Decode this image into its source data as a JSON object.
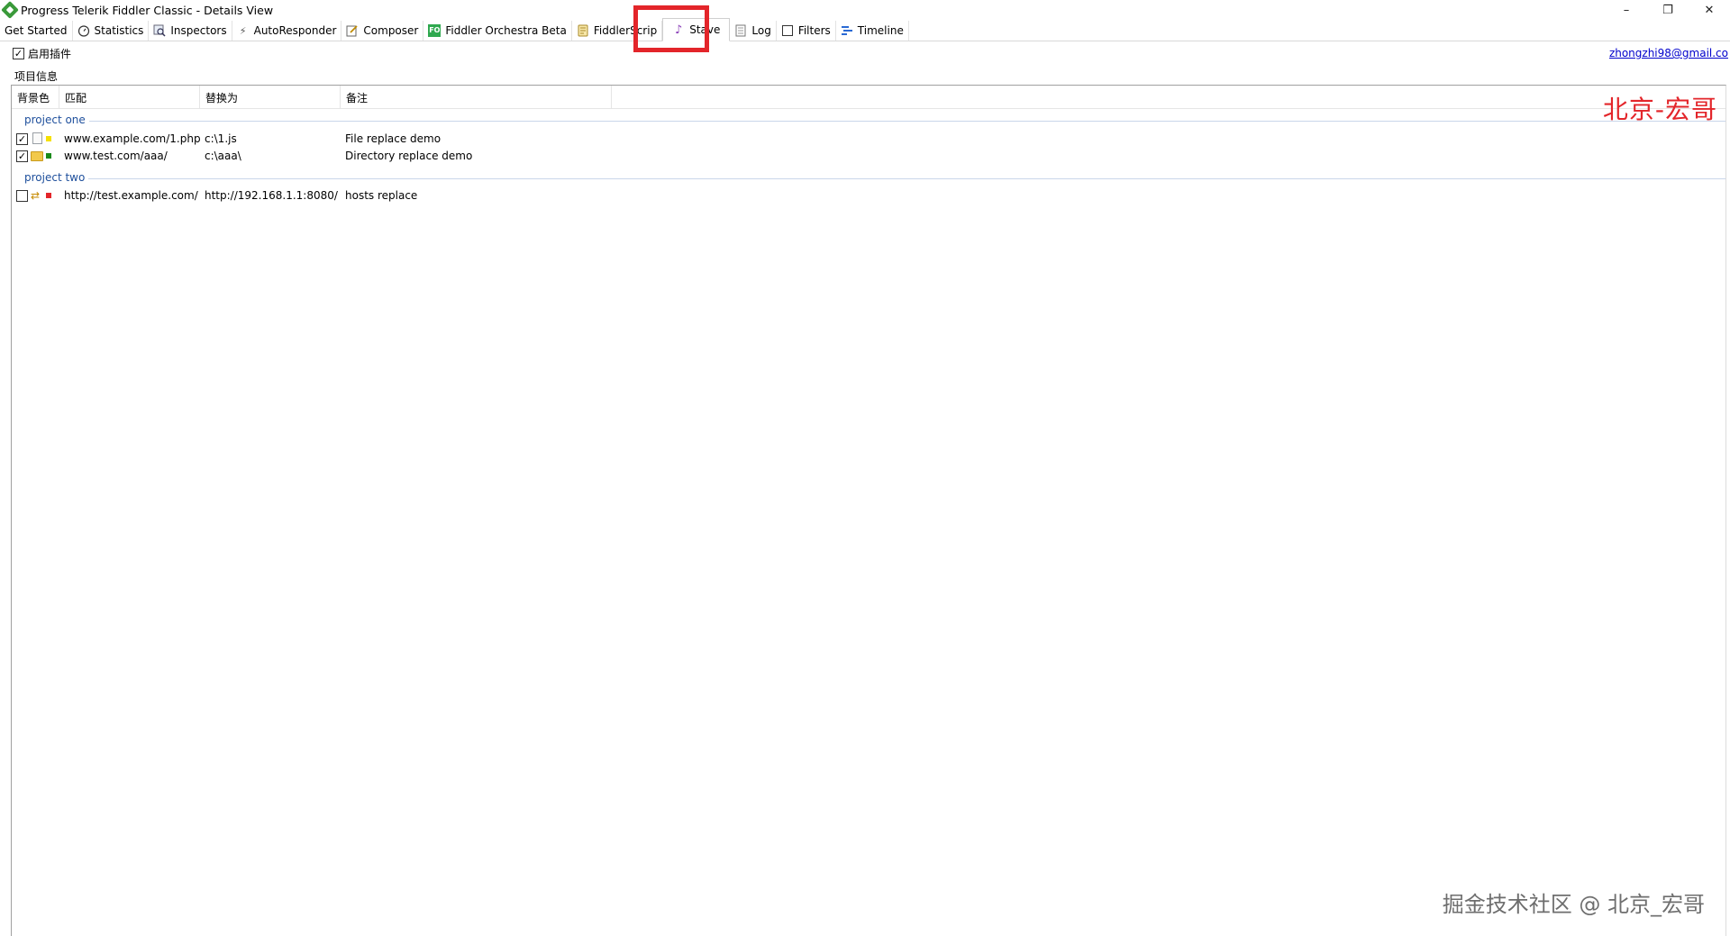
{
  "window": {
    "title": "Progress Telerik Fiddler Classic - Details View",
    "controls": {
      "minimize": "–",
      "restore": "❐",
      "close": "✕"
    }
  },
  "tabs": [
    {
      "label": "Get Started",
      "icon": ""
    },
    {
      "label": "Statistics",
      "icon": "stopwatch-icon"
    },
    {
      "label": "Inspectors",
      "icon": "inspectors-icon"
    },
    {
      "label": "AutoResponder",
      "icon": "lightning-icon"
    },
    {
      "label": "Composer",
      "icon": "composer-icon"
    },
    {
      "label": "Fiddler Orchestra Beta",
      "icon": "fo-icon"
    },
    {
      "label": "FiddlerScrip",
      "icon": "script-icon"
    },
    {
      "label": "Stave",
      "icon": "music-note-icon",
      "active": true
    },
    {
      "label": "Log",
      "icon": "log-icon"
    },
    {
      "label": "Filters",
      "icon": "filter-checkbox-icon"
    },
    {
      "label": "Timeline",
      "icon": "timeline-icon"
    }
  ],
  "plugin": {
    "enable_label": "启用插件",
    "enabled": true,
    "email": "zhongzhi98@gmail.co"
  },
  "project_info": {
    "legend": "项目信息",
    "columns": [
      "背景色",
      "匹配",
      "替换为",
      "备注"
    ],
    "groups": [
      {
        "name": "project one",
        "rows": [
          {
            "checked": true,
            "icon": "file-icon",
            "color": "#f6e000",
            "match": "www.example.com/1.php",
            "replace": "c:\\1.js",
            "note": "File replace demo"
          },
          {
            "checked": true,
            "icon": "folder-icon",
            "color": "#1a8a1a",
            "match": "www.test.com/aaa/",
            "replace": "c:\\aaa\\",
            "note": "Directory replace demo"
          }
        ]
      },
      {
        "name": "project two",
        "rows": [
          {
            "checked": false,
            "icon": "hosts-swap-icon",
            "color": "#e3252a",
            "match": "http://test.example.com/",
            "replace": "http://192.168.1.1:8080/",
            "note": "hosts replace"
          }
        ]
      }
    ]
  },
  "overlay": {
    "brand": "北京-宏哥",
    "watermark": "掘金技术社区 @ 北京_宏哥"
  },
  "colors": {
    "highlight": "#e3252a",
    "group_text": "#1e4f9c",
    "link": "#0000cc"
  }
}
